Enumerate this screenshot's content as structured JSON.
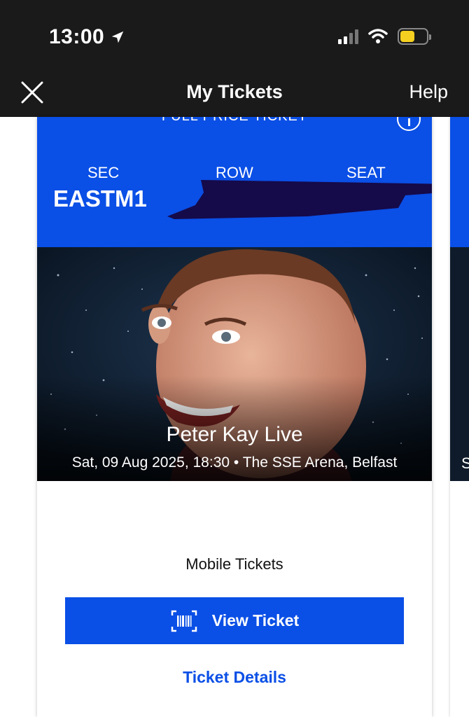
{
  "status_bar": {
    "time": "13:00"
  },
  "nav": {
    "title": "My Tickets",
    "help_label": "Help"
  },
  "ticket": {
    "type_label": "FULL PRICE TICKET",
    "sec_label": "SEC",
    "row_label": "ROW",
    "seat_label": "SEAT",
    "sec_value": "EASTM1",
    "event_name": "Peter Kay Live",
    "event_meta": "Sat, 09 Aug 2025, 18:30 • The SSE Arena, Belfast",
    "mobile_tickets_label": "Mobile Tickets",
    "view_ticket_label": "View Ticket",
    "ticket_details_label": "Ticket Details"
  },
  "next_card": {
    "meta_initial": "S"
  },
  "colors": {
    "brand_blue": "#0a4fe6",
    "topbar": "#1a1a1a",
    "redaction": "#150a4a"
  }
}
